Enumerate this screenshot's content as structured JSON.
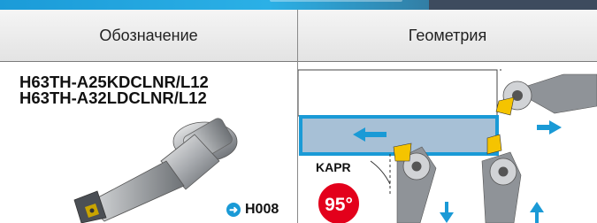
{
  "header": {
    "designation_label": "Обозначение",
    "geometry_label": "Геометрия"
  },
  "codes": [
    "H63TH-A25KDCLNR/L12",
    "H63TH-A32LDCLNR/L12"
  ],
  "reference": {
    "page": "H008",
    "icon": "arrow-right-circle-icon"
  },
  "geometry": {
    "kapr_label": "KAPR",
    "angle_value": "95°",
    "accent_color": "#1a9ad6",
    "badge_color": "#e3001b",
    "insert_color": "#f5c400"
  }
}
